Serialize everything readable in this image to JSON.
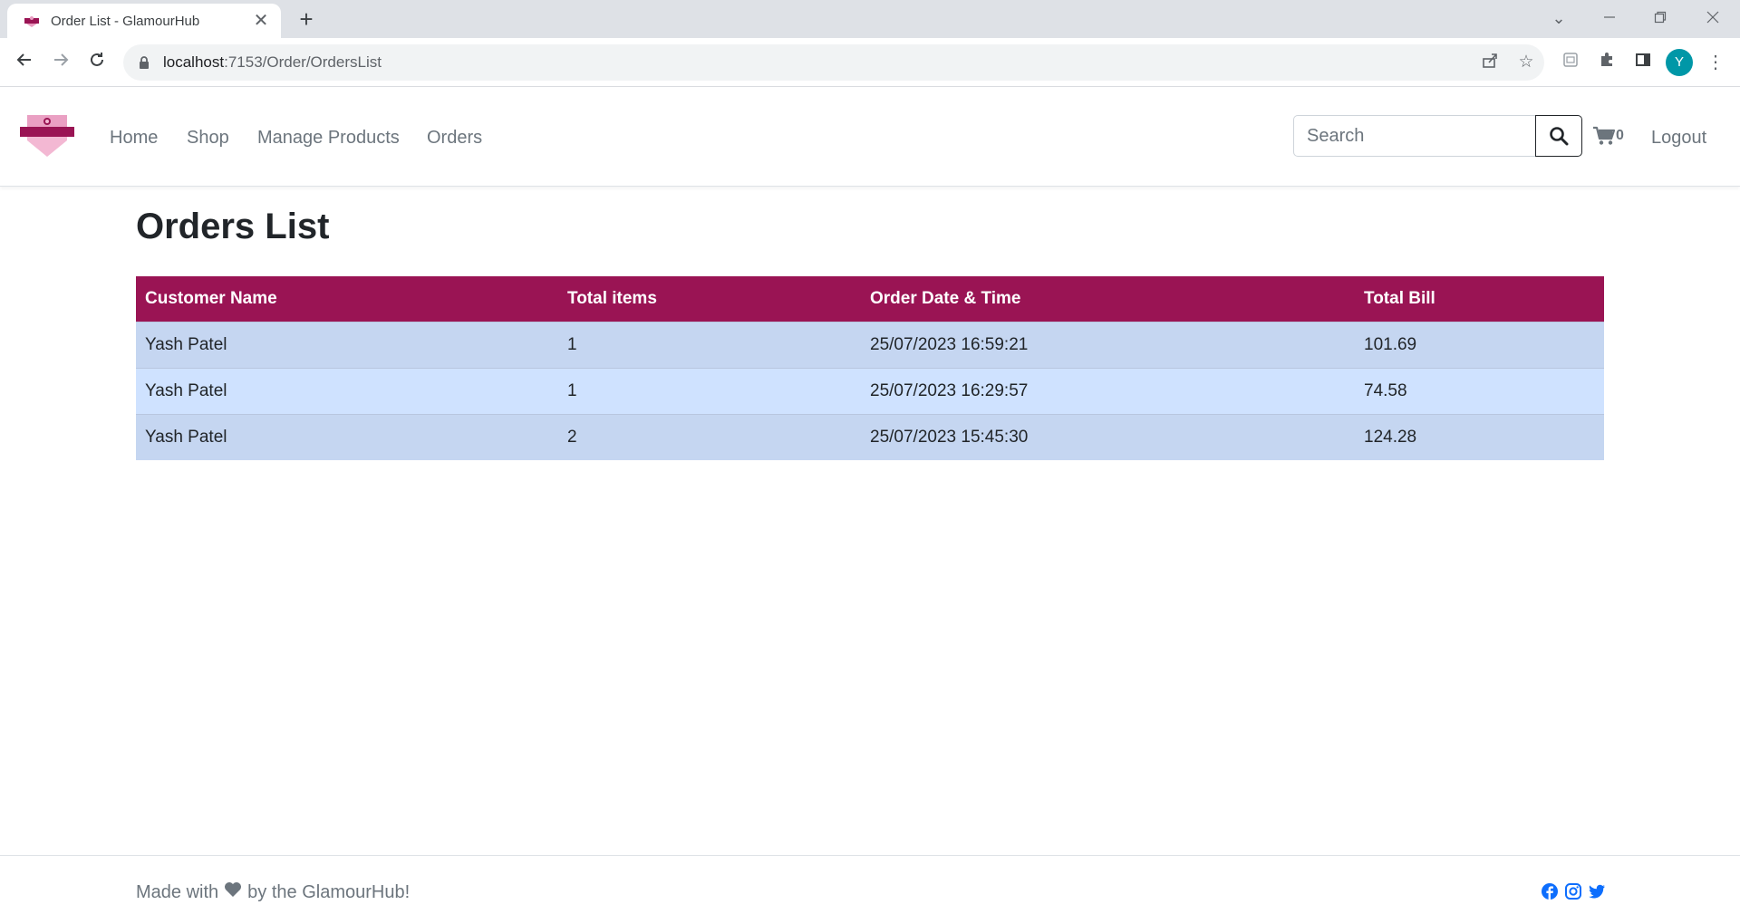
{
  "browser": {
    "tab_title": "Order List - GlamourHub",
    "tab_close": "✕",
    "new_tab": "+",
    "url_host": "localhost",
    "url_rest": ":7153/Order/OrdersList",
    "profile_initial": "Y"
  },
  "nav": {
    "links": [
      "Home",
      "Shop",
      "Manage Products",
      "Orders"
    ],
    "search_placeholder": "Search",
    "cart_count": "0",
    "logout": "Logout"
  },
  "page": {
    "title": "Orders List"
  },
  "table": {
    "headers": [
      "Customer Name",
      "Total items",
      "Order Date & Time",
      "Total Bill"
    ],
    "rows": [
      [
        "Yash Patel",
        "1",
        "25/07/2023 16:59:21",
        "101.69"
      ],
      [
        "Yash Patel",
        "1",
        "25/07/2023 16:29:57",
        "74.58"
      ],
      [
        "Yash Patel",
        "2",
        "25/07/2023 15:45:30",
        "124.28"
      ]
    ]
  },
  "footer": {
    "text_before": "Made with",
    "text_after": "by the GlamourHub!",
    "socials": [
      "facebook-icon",
      "instagram-icon",
      "twitter-icon"
    ]
  },
  "colors": {
    "brand": "#9a1454",
    "row_odd": "#c5d6f1",
    "row_even": "#cfe2ff",
    "social": "#0d6efd"
  }
}
